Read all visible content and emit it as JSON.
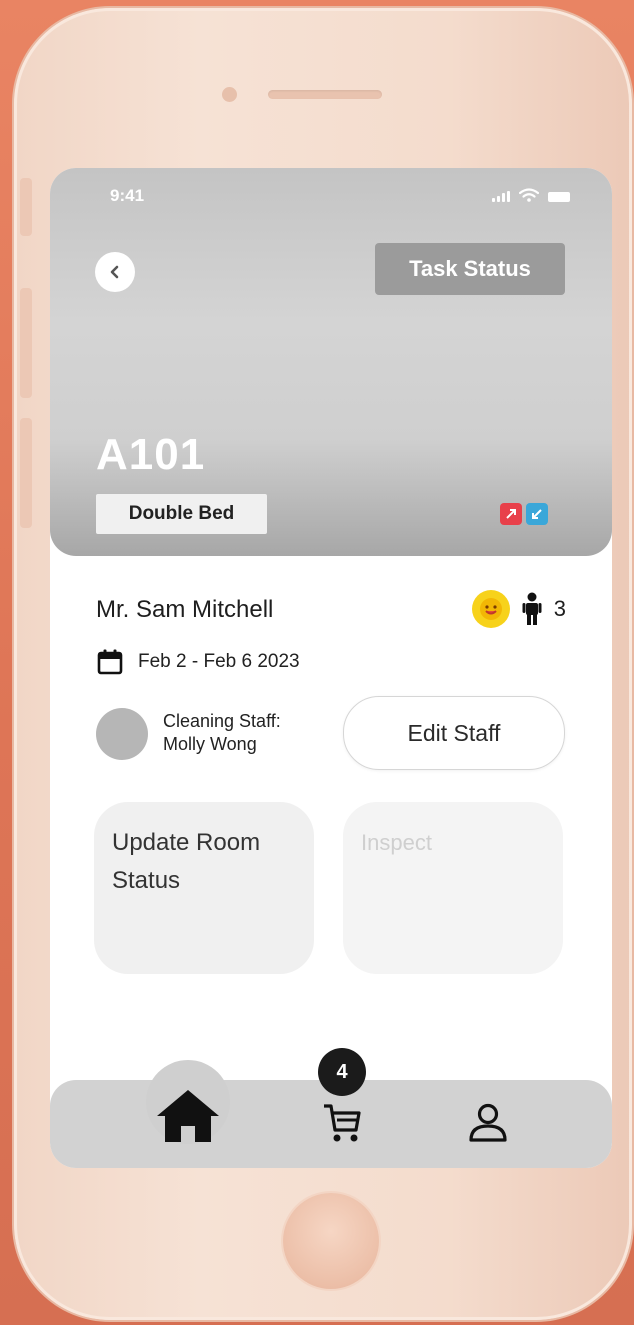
{
  "status_bar": {
    "time": "9:41"
  },
  "header": {
    "back_icon": "chevron-left-icon",
    "task_status_label": "Task Status"
  },
  "room": {
    "number": "A101",
    "bed_type": "Double Bed",
    "feature_icons": [
      "exit-icon",
      "enter-icon"
    ],
    "feature_colors": [
      "#e8404a",
      "#3aa7d9"
    ]
  },
  "guest": {
    "name": "Mr. Sam Mitchell",
    "vip_icon": "smiley-badge-icon",
    "person_icon": "person-icon",
    "count": "3",
    "dates": "Feb 2 - Feb 6 2023",
    "calendar_icon": "calendar-icon"
  },
  "staff": {
    "label": "Cleaning Staff:",
    "name": "Molly Wong",
    "edit_label": "Edit Staff"
  },
  "actions": {
    "update_room_status": "Update Room Status",
    "inspect": "Inspect"
  },
  "bottom_nav": {
    "items": [
      {
        "icon": "home-icon",
        "active": true
      },
      {
        "icon": "cart-icon",
        "badge": "4"
      },
      {
        "icon": "profile-icon"
      }
    ]
  },
  "colors": {
    "background": "#e27a5c",
    "phone_frame": "#f4dccd",
    "vip_yellow": "#f7d21b",
    "nav_bar": "#d2d2d2"
  }
}
